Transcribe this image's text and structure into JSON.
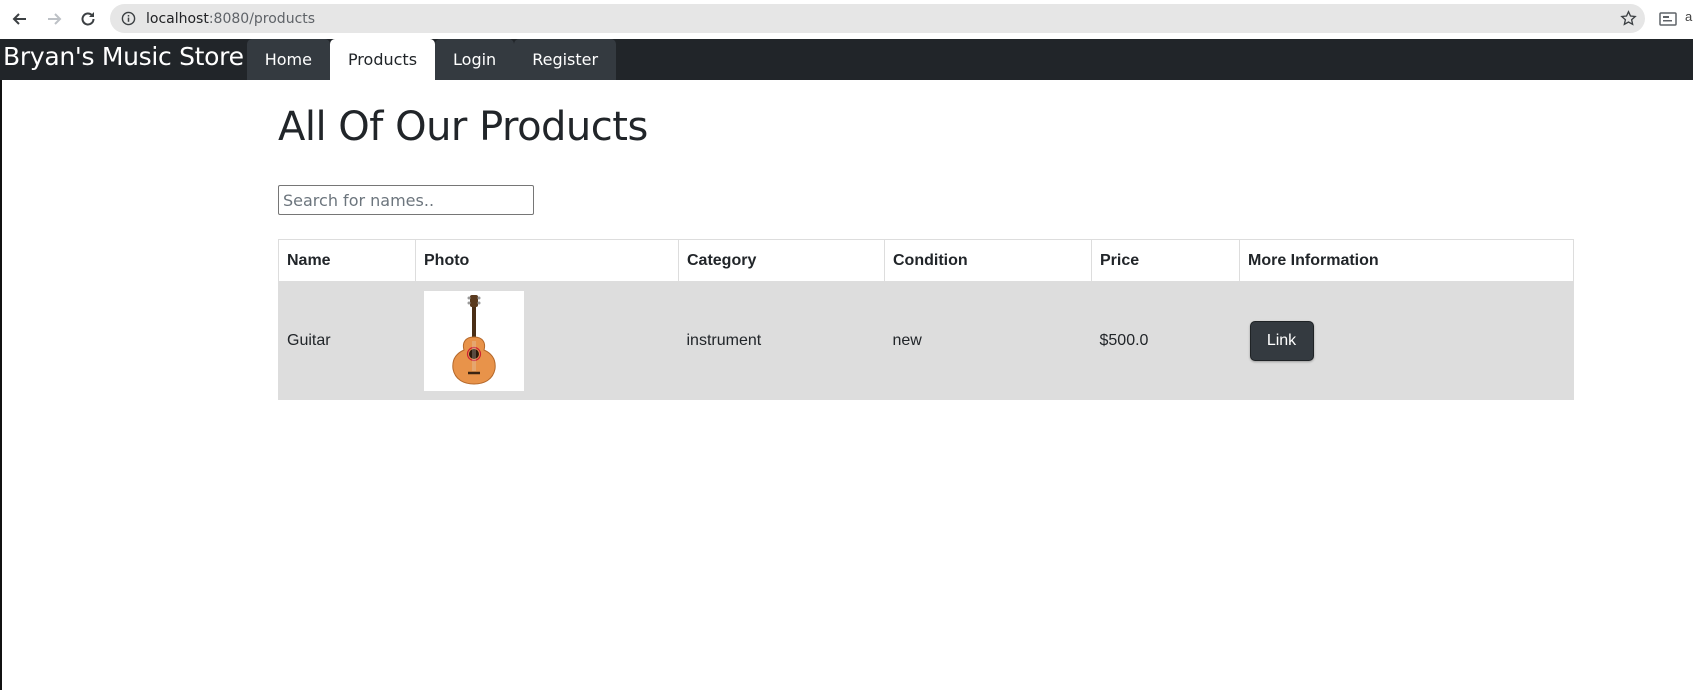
{
  "browser": {
    "url_host": "localhost",
    "url_path": ":8080/products"
  },
  "navbar": {
    "brand": "Bryan's Music Store",
    "tabs": [
      {
        "label": "Home",
        "active": false
      },
      {
        "label": "Products",
        "active": true
      },
      {
        "label": "Login",
        "active": false
      },
      {
        "label": "Register",
        "active": false
      }
    ]
  },
  "main": {
    "title": "All Of Our Products",
    "search_placeholder": "Search for names..",
    "search_value": ""
  },
  "table": {
    "headers": [
      "Name",
      "Photo",
      "Category",
      "Condition",
      "Price",
      "More Information"
    ],
    "rows": [
      {
        "name": "Guitar",
        "photo": "guitar-image",
        "category": "instrument",
        "condition": "new",
        "price": "$500.0",
        "link_label": "Link"
      }
    ]
  },
  "colors": {
    "navbar_bg": "#212529",
    "tab_bg": "#343a40",
    "row_bg": "#dddddd",
    "button_bg": "#343a40"
  }
}
